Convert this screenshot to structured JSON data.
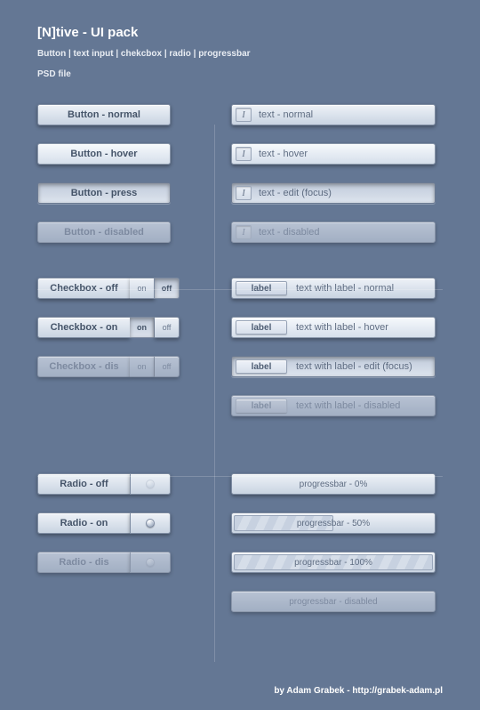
{
  "header": {
    "title": "[N]tive - UI pack",
    "subtitle": "Button | text input | chekcbox | radio | progressbar",
    "file": "PSD file"
  },
  "buttons": {
    "normal": "Button - normal",
    "hover": "Button - hover",
    "press": "Button - press",
    "disabled": "Button - disabled"
  },
  "textinputs": {
    "ibeam": "I",
    "normal": "text - normal",
    "hover": "text - hover",
    "focus": "text - edit (focus)",
    "disabled": "text - disabled"
  },
  "checkbox": {
    "off_label": "Checkbox - off",
    "on_label": "Checkbox - on",
    "dis_label": "Checkbox - dis",
    "on": "on",
    "off": "off"
  },
  "labelled": {
    "tag": "label",
    "normal": "text with label - normal",
    "hover": "text with label - hover",
    "focus": "text with label - edit (focus)",
    "disabled": "text with label - disabled"
  },
  "radio": {
    "off_label": "Radio - off",
    "on_label": "Radio - on",
    "dis_label": "Radio - dis"
  },
  "progress": {
    "p0": "progressbar - 0%",
    "p50": "progressbar - 50%",
    "p100": "progressbar - 100%",
    "dis": "progressbar - disabled"
  },
  "footer": "by Adam Grabek - http://grabek-adam.pl"
}
